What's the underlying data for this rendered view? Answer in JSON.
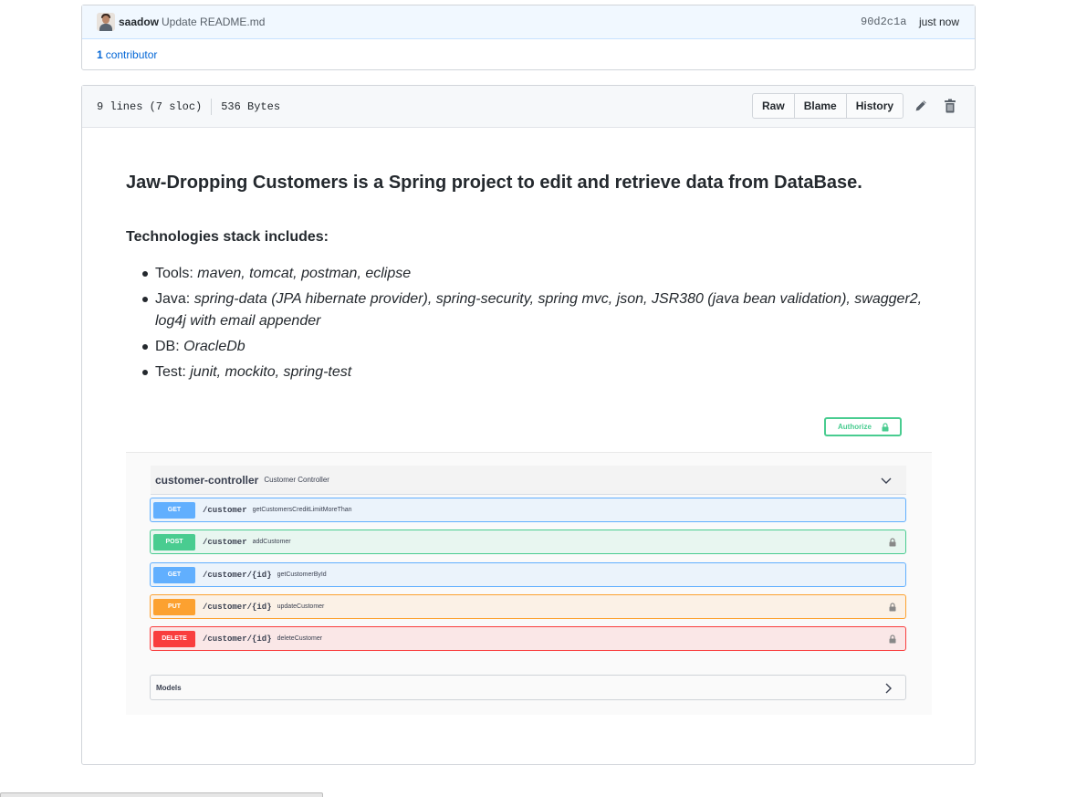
{
  "commit": {
    "author": "saadow",
    "message": "Update README.md",
    "sha": "90d2c1a",
    "time": "just now",
    "contributors_count": "1",
    "contributors_label": "contributor"
  },
  "file": {
    "lines": "9 lines (7 sloc)",
    "size": "536 Bytes",
    "buttons": {
      "raw": "Raw",
      "blame": "Blame",
      "history": "History"
    },
    "icons": [
      "pencil-icon",
      "trash-icon"
    ]
  },
  "readme": {
    "title": "Jaw-Dropping Customers is a Spring project to edit and retrieve data from DataBase.",
    "subtitle": "Technologies stack includes:",
    "items": [
      {
        "label": "Tools:",
        "value": "maven, tomcat, postman, eclipse"
      },
      {
        "label": "Java:",
        "value": "spring-data (JPA hibernate provider), spring-security, spring mvc, json, JSR380 (java bean validation), swagger2, log4j with email appender"
      },
      {
        "label": "DB:",
        "value": "OracleDb"
      },
      {
        "label": "Test:",
        "value": "junit, mockito, spring-test"
      }
    ]
  },
  "swagger": {
    "authorize_label": "Authorize",
    "controller_name": "customer-controller",
    "controller_desc": "Customer Controller",
    "operations": [
      {
        "method": "GET",
        "path": "/customer",
        "desc": "getCustomersCreditLimitMoreThan",
        "locked": false,
        "color": "#61affe",
        "bg": "#ebf3fb",
        "border": "#61affe"
      },
      {
        "method": "POST",
        "path": "/customer",
        "desc": "addCustomer",
        "locked": true,
        "color": "#49cc90",
        "bg": "#e8f6f0",
        "border": "#49cc90"
      },
      {
        "method": "GET",
        "path": "/customer/{id}",
        "desc": "getCustomerById",
        "locked": false,
        "color": "#61affe",
        "bg": "#ebf3fb",
        "border": "#61affe"
      },
      {
        "method": "PUT",
        "path": "/customer/{id}",
        "desc": "updateCustomer",
        "locked": true,
        "color": "#fca130",
        "bg": "#fbf1e6",
        "border": "#fca130"
      },
      {
        "method": "DELETE",
        "path": "/customer/{id}",
        "desc": "deleteCustomer",
        "locked": true,
        "color": "#f93e3e",
        "bg": "#fae7e7",
        "border": "#f93e3e"
      }
    ],
    "models_label": "Models"
  }
}
